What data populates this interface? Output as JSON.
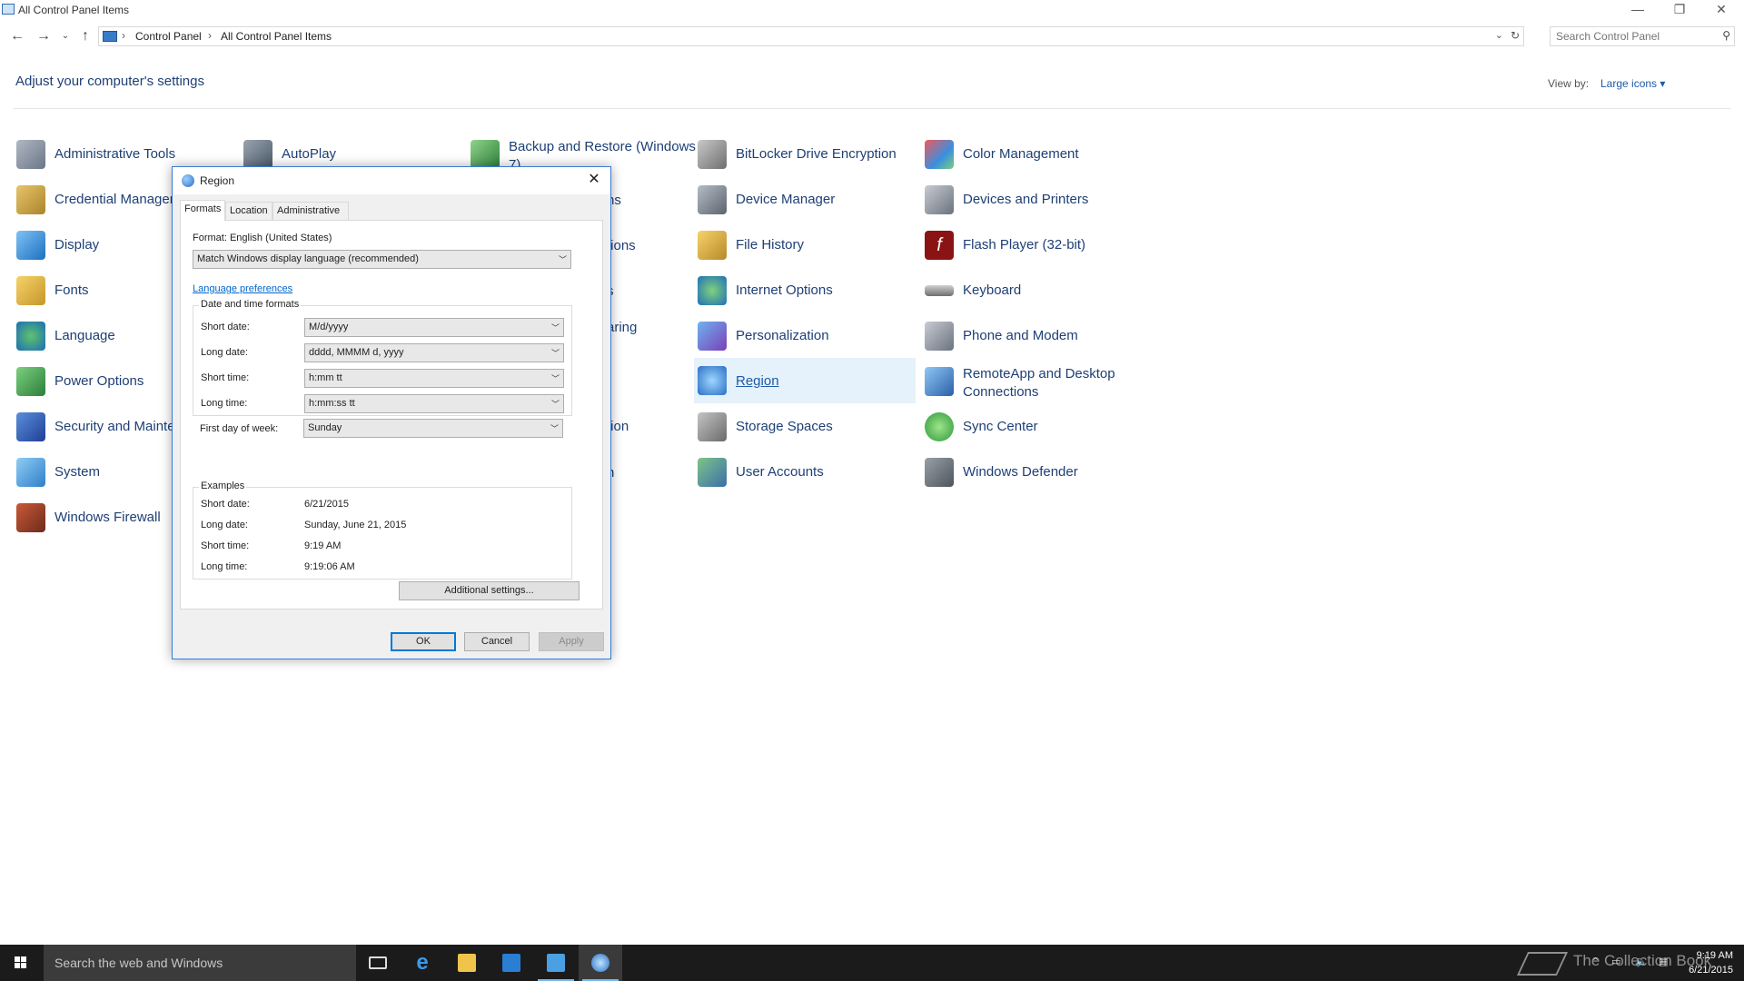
{
  "window": {
    "title": "All Control Panel Items",
    "minimize": "—",
    "restore": "❐",
    "close": "✕"
  },
  "address": {
    "crumbs": [
      "Control Panel",
      "All Control Panel Items"
    ],
    "search_placeholder": "Search Control Panel"
  },
  "header": {
    "title": "Adjust your computer's settings",
    "view_by_label": "View by:",
    "view_by_value": "Large icons ▾"
  },
  "items": {
    "administrative_tools": "Administrative Tools",
    "autoplay": "AutoPlay",
    "backup_restore": "Backup and Restore (Windows 7)",
    "bitlocker": "BitLocker Drive Encryption",
    "color_management": "Color Management",
    "credential_manager": "Credential Manager",
    "device_manager": "Device Manager",
    "devices_printers": "Devices and Printers",
    "display": "Display",
    "file_history": "File History",
    "flash_player": "Flash Player (32-bit)",
    "fonts": "Fonts",
    "internet_options": "Internet Options",
    "keyboard": "Keyboard",
    "language": "Language",
    "personalization": "Personalization",
    "phone_modem": "Phone and Modem",
    "power_options": "Power Options",
    "region": "Region",
    "remoteapp": "RemoteApp and Desktop Connections",
    "security_maintenance": "Security and Maintenance",
    "storage_spaces": "Storage Spaces",
    "sync_center": "Sync Center",
    "system": "System",
    "user_accounts": "User Accounts",
    "windows_defender": "Windows Defender",
    "windows_firewall": "Windows Firewall",
    "partial_col3": [
      "ns",
      "tions",
      "s",
      "aring",
      "tion",
      "n"
    ]
  },
  "dialog": {
    "title": "Region",
    "close": "✕",
    "tabs": [
      "Formats",
      "Location",
      "Administrative"
    ],
    "format_label": "Format: English (United States)",
    "format_value": "Match Windows display language (recommended)",
    "language_link": "Language preferences",
    "datetime_group": "Date and time formats",
    "formats": [
      {
        "label": "Short date:",
        "value": "M/d/yyyy"
      },
      {
        "label": "Long date:",
        "value": "dddd, MMMM d, yyyy"
      },
      {
        "label": "Short time:",
        "value": "h:mm tt"
      },
      {
        "label": "Long time:",
        "value": "h:mm:ss tt"
      },
      {
        "label": "First day of week:",
        "value": "Sunday"
      }
    ],
    "examples_group": "Examples",
    "examples": [
      {
        "label": "Short date:",
        "value": "6/21/2015"
      },
      {
        "label": "Long date:",
        "value": "Sunday, June 21, 2015"
      },
      {
        "label": "Short time:",
        "value": "9:19 AM"
      },
      {
        "label": "Long time:",
        "value": "9:19:06 AM"
      }
    ],
    "additional_settings": "Additional settings...",
    "ok": "OK",
    "cancel": "Cancel",
    "apply": "Apply"
  },
  "taskbar": {
    "search_text": "Search the web and Windows",
    "watermark": "The Collection Book",
    "time": "9:19 AM",
    "date": "6/21/2015"
  }
}
